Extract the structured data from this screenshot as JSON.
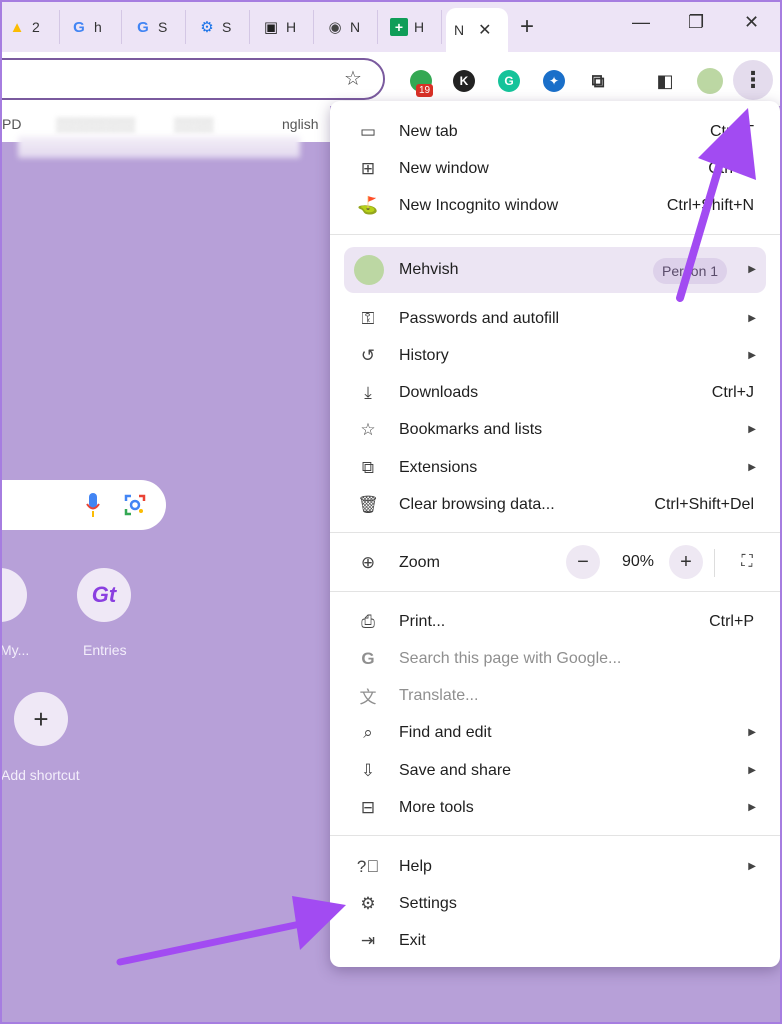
{
  "tabs": [
    {
      "glyph": "▲",
      "title": "2",
      "color": "#1a73e8"
    },
    {
      "glyph": "G",
      "title": "h",
      "color": "#4285f4"
    },
    {
      "glyph": "G",
      "title": "S",
      "color": "#4285f4"
    },
    {
      "glyph": "⚙",
      "title": "S",
      "color": "#1a73e8"
    },
    {
      "glyph": "▣",
      "title": "H",
      "color": "#222"
    },
    {
      "glyph": "◉",
      "title": "N",
      "color": "#333"
    },
    {
      "glyph": "+",
      "title": "H",
      "color": "#0f9d58"
    },
    {
      "glyph": "",
      "title": "N",
      "color": "#333"
    }
  ],
  "window": {
    "minimize": "—",
    "restore": "❐",
    "close": "✕",
    "newtab": "+"
  },
  "toolbar": {
    "badge_count": "19",
    "ext_k": "K",
    "ext_g": "G"
  },
  "bookmarks": {
    "pdf": "PD",
    "english": "nglish"
  },
  "ntp": {
    "shortcut_my": "My...",
    "shortcut_entries": "Entries",
    "add_shortcut": "Add shortcut",
    "add_symbol": "+",
    "entries_glyph": "Gt"
  },
  "menu": {
    "new_tab": {
      "label": "New tab",
      "shortcut": "Ctrl+T"
    },
    "new_window": {
      "label": "New window",
      "shortcut": "Ctrl+N"
    },
    "incognito": {
      "label": "New Incognito window",
      "shortcut": "Ctrl+Shift+N"
    },
    "profile": {
      "name": "Mehvish",
      "badge": "Person 1"
    },
    "passwords": {
      "label": "Passwords and autofill"
    },
    "history": {
      "label": "History"
    },
    "downloads": {
      "label": "Downloads",
      "shortcut": "Ctrl+J"
    },
    "bookmarks": {
      "label": "Bookmarks and lists"
    },
    "extensions": {
      "label": "Extensions"
    },
    "clear": {
      "label": "Clear browsing data...",
      "shortcut": "Ctrl+Shift+Del"
    },
    "zoom": {
      "label": "Zoom",
      "value": "90%",
      "minus": "−",
      "plus": "+"
    },
    "print": {
      "label": "Print...",
      "shortcut": "Ctrl+P"
    },
    "search_page": {
      "label": "Search this page with Google..."
    },
    "translate": {
      "label": "Translate..."
    },
    "find_edit": {
      "label": "Find and edit"
    },
    "save_share": {
      "label": "Save and share"
    },
    "more_tools": {
      "label": "More tools"
    },
    "help": {
      "label": "Help"
    },
    "settings": {
      "label": "Settings"
    },
    "exit": {
      "label": "Exit"
    }
  },
  "colors": {
    "background": "#b7a0d8",
    "accent_arrow": "#a24bf2",
    "menu_bg": "#ffffff"
  }
}
